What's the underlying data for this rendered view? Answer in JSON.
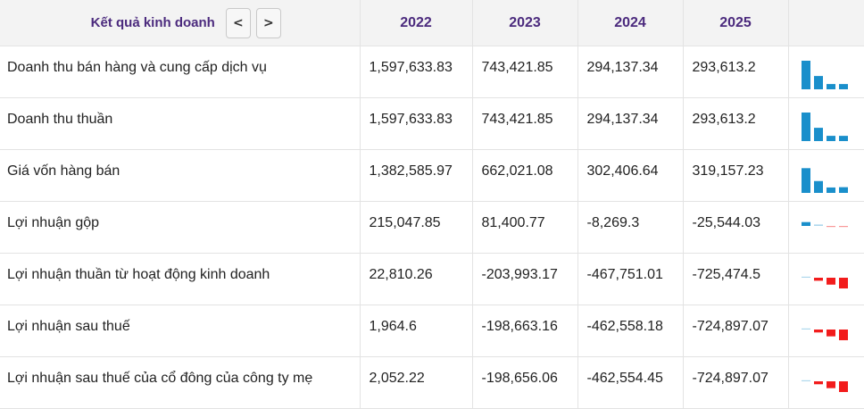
{
  "header": {
    "title": "Kết quả kinh doanh",
    "prev_label": "<",
    "next_label": ">",
    "years": [
      "2022",
      "2023",
      "2024",
      "2025"
    ]
  },
  "colors": {
    "positive": "#1a8fcb",
    "negative": "#f21c1c"
  },
  "rows": [
    {
      "label": "Doanh thu bán hàng và cung cấp dịch vụ",
      "cells": [
        "1,597,633.83",
        "743,421.85",
        "294,137.34",
        "293,613.2"
      ],
      "values": [
        1597633.83,
        743421.85,
        294137.34,
        293613.2
      ]
    },
    {
      "label": "Doanh thu thuần",
      "cells": [
        "1,597,633.83",
        "743,421.85",
        "294,137.34",
        "293,613.2"
      ],
      "values": [
        1597633.83,
        743421.85,
        294137.34,
        293613.2
      ]
    },
    {
      "label": "Giá vốn hàng bán",
      "cells": [
        "1,382,585.97",
        "662,021.08",
        "302,406.64",
        "319,157.23"
      ],
      "values": [
        1382585.97,
        662021.08,
        302406.64,
        319157.23
      ]
    },
    {
      "label": "Lợi nhuận gộp",
      "cells": [
        "215,047.85",
        "81,400.77",
        "-8,269.3",
        "-25,544.03"
      ],
      "values": [
        215047.85,
        81400.77,
        -8269.3,
        -25544.03
      ]
    },
    {
      "label": "Lợi nhuận thuần từ hoạt động kinh doanh",
      "cells": [
        "22,810.26",
        "-203,993.17",
        "-467,751.01",
        "-725,474.5"
      ],
      "values": [
        22810.26,
        -203993.17,
        -467751.01,
        -725474.5
      ]
    },
    {
      "label": "Lợi nhuận sau thuế",
      "cells": [
        "1,964.6",
        "-198,663.16",
        "-462,558.18",
        "-724,897.07"
      ],
      "values": [
        1964.6,
        -198663.16,
        -462558.18,
        -724897.07
      ]
    },
    {
      "label": "Lợi nhuận sau thuế của cổ đông của công ty mẹ",
      "cells": [
        "2,052.22",
        "-198,656.06",
        "-462,554.45",
        "-724,897.07"
      ],
      "values": [
        2052.22,
        -198656.06,
        -462554.45,
        -724897.07
      ]
    }
  ]
}
